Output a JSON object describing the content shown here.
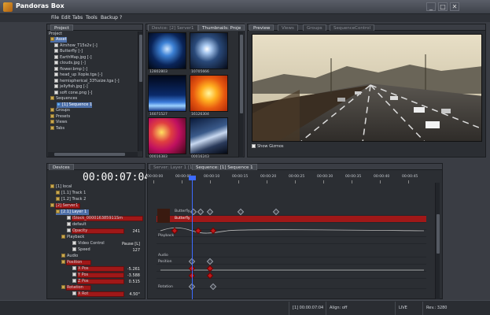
{
  "window": {
    "title": "Pandoras Box",
    "btn_min": "_",
    "btn_max": "□",
    "btn_close": "✕"
  },
  "menu": [
    "File",
    "Edit",
    "Tabs",
    "Tools",
    "Backup",
    "?"
  ],
  "project": {
    "tab": "Project",
    "root": "Project",
    "items": [
      {
        "label": "Asset",
        "type": "folder",
        "selected": true
      },
      {
        "label": "Airshow_T15s2v [-]",
        "type": "file"
      },
      {
        "label": "Butterfly [-]",
        "type": "file"
      },
      {
        "label": "EarthMap.jpg [-]",
        "type": "file"
      },
      {
        "label": "clouds.jpg [-]",
        "type": "file"
      },
      {
        "label": "flower.bmp [-]",
        "type": "file"
      },
      {
        "label": "head_up Xople.tga [-]",
        "type": "file"
      },
      {
        "label": "hemispherical_33%size.tga [-]",
        "type": "file"
      },
      {
        "label": "jellyfish.jpg [-]",
        "type": "file"
      },
      {
        "label": "soft cone.png [-]",
        "type": "file"
      },
      {
        "label": "Sequences",
        "type": "folder"
      },
      {
        "label": "[1] Sequence 1",
        "type": "seq",
        "selected": true
      },
      {
        "label": "Groups",
        "type": "folder"
      },
      {
        "label": "Presets",
        "type": "folder"
      },
      {
        "label": "Views",
        "type": "folder"
      },
      {
        "label": "Tabs",
        "type": "folder"
      }
    ]
  },
  "thumbnails": {
    "tab_device": "Device: [2] Server1",
    "tab_thumbs": "Thumbnails: Proje",
    "items": [
      {
        "label": "12802803"
      },
      {
        "label": "10705666"
      },
      {
        "label": "16071527"
      },
      {
        "label": "16126304"
      },
      {
        "label": "00016383"
      },
      {
        "label": "00016243"
      }
    ]
  },
  "preview": {
    "tab": "Preview",
    "tabs_inactive": [
      "Views",
      "Groups",
      "SequenceControl"
    ],
    "show_gizmos": "Show Gizmos"
  },
  "devices": {
    "tab": "Devices",
    "timecode": "00:00:07:04",
    "rows": [
      {
        "label": "[1] local",
        "indent": 0
      },
      {
        "label": "[1.1] Track 1",
        "indent": 1
      },
      {
        "label": "[1.2] Track 2",
        "indent": 1
      },
      {
        "label": "[2] Server1",
        "indent": 0,
        "red": true
      },
      {
        "label": "[2.1] Layer 1",
        "indent": 1,
        "selected": true
      },
      {
        "label": "iStock_000016385911Sm",
        "indent": 3,
        "red": true
      },
      {
        "label": "default",
        "indent": 3
      },
      {
        "label": "Opacity",
        "indent": 3,
        "red": true,
        "value": "241"
      },
      {
        "label": "Playback",
        "indent": 2
      },
      {
        "label": "Video Control",
        "indent": 4,
        "value": "Pause [L]"
      },
      {
        "label": "Speed",
        "indent": 4,
        "value": "127"
      },
      {
        "label": "Audio",
        "indent": 2
      },
      {
        "label": "Position",
        "indent": 2,
        "red": true
      },
      {
        "label": "X Pos",
        "indent": 4,
        "red": true,
        "value": "-5.261"
      },
      {
        "label": "Y Pos",
        "indent": 4,
        "red": true,
        "value": "-3.588"
      },
      {
        "label": "Z Pos",
        "indent": 4,
        "red": true,
        "value": "0.515"
      },
      {
        "label": "Rotation",
        "indent": 2,
        "red": true
      },
      {
        "label": "X Rot",
        "indent": 4,
        "red": true,
        "value": "4.50°"
      }
    ]
  },
  "sequence": {
    "tab_inactive": "Server: Layer 1 [1]",
    "tab_active": "Sequence: [1] Sequence 1",
    "ruler": [
      "00:00:00",
      "00:00:05",
      "00:00:10",
      "00:00:15",
      "00:00:20",
      "00:00:25",
      "00:00:30",
      "00:00:35",
      "00:00:40",
      "00:00:45"
    ],
    "track_labels": {
      "butterfly1": "Butterfly",
      "butterfly2": "Butterfly",
      "playback": "Playback",
      "audio": "Audio",
      "position": "Position",
      "rotation": "Rotation"
    }
  },
  "status": {
    "timecode": "[1] 00:00:07:04",
    "align": "Align: off",
    "live": "LIVE",
    "rev": "Rev.: 3280"
  },
  "colors": {
    "accent": "#a01818",
    "selection": "#4d6fa8",
    "panel": "#2b2e33"
  }
}
